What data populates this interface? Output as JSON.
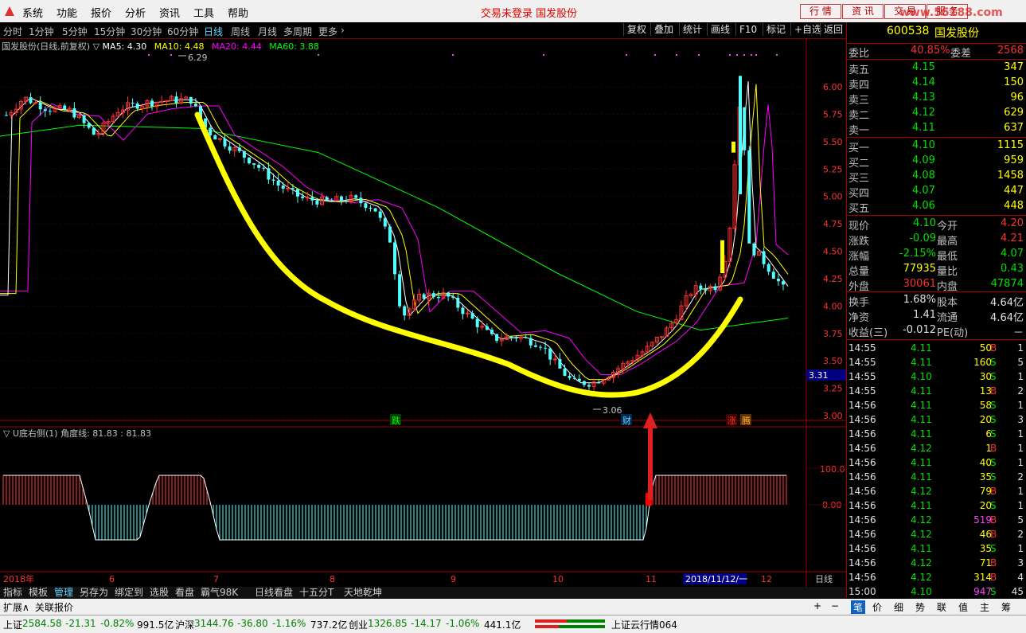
{
  "menubar": {
    "items": [
      "系统",
      "功能",
      "报价",
      "分析",
      "资讯",
      "工具",
      "帮助"
    ],
    "status": "交易未登录  国发股份",
    "buttons": [
      "行 情",
      "资 讯",
      "交 易",
      "服 务"
    ],
    "watermark": "www.55188.com"
  },
  "toolbar": {
    "periods": [
      "分时",
      "1分钟",
      "5分钟",
      "15分钟",
      "30分钟",
      "60分钟",
      "日线",
      "周线",
      "月线",
      "多周期",
      "更多"
    ],
    "active_period": "日线",
    "right_buttons": [
      "复权",
      "叠加",
      "统计",
      "画线",
      "F10",
      "标记",
      "+自选",
      "返回"
    ]
  },
  "ma": {
    "title": "国发股份(日线,前复权) ▽",
    "ma5": "MA5: 4.30",
    "ma10": "MA10: 4.48",
    "ma20": "MA20: 4.44",
    "ma60": "MA60: 3.88",
    "colors": {
      "ma5": "#ffffff",
      "ma10": "#ffff00",
      "ma20": "#ff00ff",
      "ma60": "#00ff00"
    }
  },
  "price_axis": [
    "6.00",
    "5.75",
    "5.50",
    "5.25",
    "5.00",
    "4.75",
    "4.50",
    "4.25",
    "4.00",
    "3.75",
    "3.50",
    "3.25",
    "3.00"
  ],
  "price_current_tag": "3.31",
  "annotations": {
    "high": "6.29",
    "low": "3.06",
    "label_die": "跌",
    "label_cai": "财",
    "label_zhang": "涨",
    "label_teng": "腾"
  },
  "indicator": {
    "title": "▽ U底右侧(1)  角度线: 81.83  : 81.83",
    "axis": [
      "100.0",
      "0.00"
    ]
  },
  "date_axis": {
    "labels": [
      "2018年",
      "6",
      "7",
      "8",
      "9",
      "10",
      "11",
      "12"
    ],
    "highlight": "2018/11/12/一",
    "right_label": "日线"
  },
  "bottom_tabs": [
    "指标",
    "模板",
    "管理",
    "另存为",
    "绑定到",
    "选股",
    "看盘",
    "霸气98K",
    "日线看盘",
    "十五分T",
    "天地乾坤"
  ],
  "bottom_active_tab": "管理",
  "expand": {
    "expand_label": "扩展∧",
    "related_label": "关联报价"
  },
  "quote": {
    "code": "600538",
    "name": "国发股份",
    "weibi_label": "委比",
    "weibi": "40.85%",
    "weicha_label": "委差",
    "weicha": "2568",
    "sells": [
      {
        "label": "卖五",
        "price": "4.15",
        "vol": "347"
      },
      {
        "label": "卖四",
        "price": "4.14",
        "vol": "150"
      },
      {
        "label": "卖三",
        "price": "4.13",
        "vol": "96"
      },
      {
        "label": "卖二",
        "price": "4.12",
        "vol": "629"
      },
      {
        "label": "卖一",
        "price": "4.11",
        "vol": "637"
      }
    ],
    "buys": [
      {
        "label": "买一",
        "price": "4.10",
        "vol": "1115"
      },
      {
        "label": "买二",
        "price": "4.09",
        "vol": "959"
      },
      {
        "label": "买三",
        "price": "4.08",
        "vol": "1458"
      },
      {
        "label": "买四",
        "price": "4.07",
        "vol": "447"
      },
      {
        "label": "买五",
        "price": "4.06",
        "vol": "448"
      }
    ],
    "stats": [
      {
        "l1": "现价",
        "v1": "4.10",
        "c1": "#00e000",
        "l2": "今开",
        "v2": "4.20",
        "c2": "#ff3030"
      },
      {
        "l1": "涨跌",
        "v1": "-0.09",
        "c1": "#00e000",
        "l2": "最高",
        "v2": "4.21",
        "c2": "#ff3030"
      },
      {
        "l1": "涨幅",
        "v1": "-2.15%",
        "c1": "#00e000",
        "l2": "最低",
        "v2": "4.07",
        "c2": "#00e000"
      },
      {
        "l1": "总量",
        "v1": "77935",
        "c1": "#ffff00",
        "l2": "量比",
        "v2": "0.43",
        "c2": "#00e000"
      },
      {
        "l1": "外盘",
        "v1": "30061",
        "c1": "#ff3030",
        "l2": "内盘",
        "v2": "47874",
        "c2": "#00e000"
      }
    ],
    "stats2": [
      {
        "l1": "换手",
        "v1": "1.68%",
        "l2": "股本",
        "v2": "4.64亿"
      },
      {
        "l1": "净资",
        "v1": "1.41",
        "l2": "流通",
        "v2": "4.64亿"
      },
      {
        "l1": "收益(三)",
        "v1": "-0.012",
        "l2": "PE(动)",
        "v2": "－"
      }
    ],
    "ticks": [
      {
        "t": "14:55",
        "p": "4.11",
        "v": "50",
        "bs": "B",
        "n": "1"
      },
      {
        "t": "14:55",
        "p": "4.11",
        "v": "160",
        "bs": "S",
        "n": "5"
      },
      {
        "t": "14:55",
        "p": "4.10",
        "v": "30",
        "bs": "S",
        "n": "1"
      },
      {
        "t": "14:55",
        "p": "4.11",
        "v": "13",
        "bs": "B",
        "n": "2"
      },
      {
        "t": "14:56",
        "p": "4.11",
        "v": "58",
        "bs": "S",
        "n": "1"
      },
      {
        "t": "14:56",
        "p": "4.11",
        "v": "20",
        "bs": "S",
        "n": "3"
      },
      {
        "t": "14:56",
        "p": "4.11",
        "v": "6",
        "bs": "S",
        "n": "1"
      },
      {
        "t": "14:56",
        "p": "4.12",
        "v": "1",
        "bs": "B",
        "n": "1"
      },
      {
        "t": "14:56",
        "p": "4.11",
        "v": "40",
        "bs": "S",
        "n": "1"
      },
      {
        "t": "14:56",
        "p": "4.11",
        "v": "35",
        "bs": "S",
        "n": "2"
      },
      {
        "t": "14:56",
        "p": "4.12",
        "v": "79",
        "bs": "B",
        "n": "1"
      },
      {
        "t": "14:56",
        "p": "4.11",
        "v": "20",
        "bs": "S",
        "n": "1"
      },
      {
        "t": "14:56",
        "p": "4.12",
        "v": "519",
        "bs": "B",
        "n": "5"
      },
      {
        "t": "14:56",
        "p": "4.12",
        "v": "46",
        "bs": "B",
        "n": "2"
      },
      {
        "t": "14:56",
        "p": "4.11",
        "v": "35",
        "bs": "S",
        "n": "1"
      },
      {
        "t": "14:56",
        "p": "4.12",
        "v": "71",
        "bs": "B",
        "n": "3"
      },
      {
        "t": "14:56",
        "p": "4.12",
        "v": "314",
        "bs": "B",
        "n": "4"
      },
      {
        "t": "15:00",
        "p": "4.10",
        "v": "947",
        "bs": "S",
        "n": "45"
      }
    ],
    "bottom_tabs": [
      "笔",
      "价",
      "细",
      "势",
      "联",
      "值",
      "主",
      "筹"
    ]
  },
  "statusbar": {
    "sh_label": "上证",
    "sh_val": "2584.58",
    "sh_chg": "-21.31",
    "sh_pct": "-0.82%",
    "sh_amt": "991.5亿",
    "hs_label": "沪深",
    "hs_val": "3144.76",
    "hs_chg": "-36.80",
    "hs_pct": "-1.16%",
    "hs_amt": "737.2亿",
    "cy_label": "创业",
    "cy_val": "1326.85",
    "cy_chg": "-14.17",
    "cy_pct": "-1.06%",
    "cy_amt": "441.1亿",
    "cloud": "上证云行情064"
  }
}
